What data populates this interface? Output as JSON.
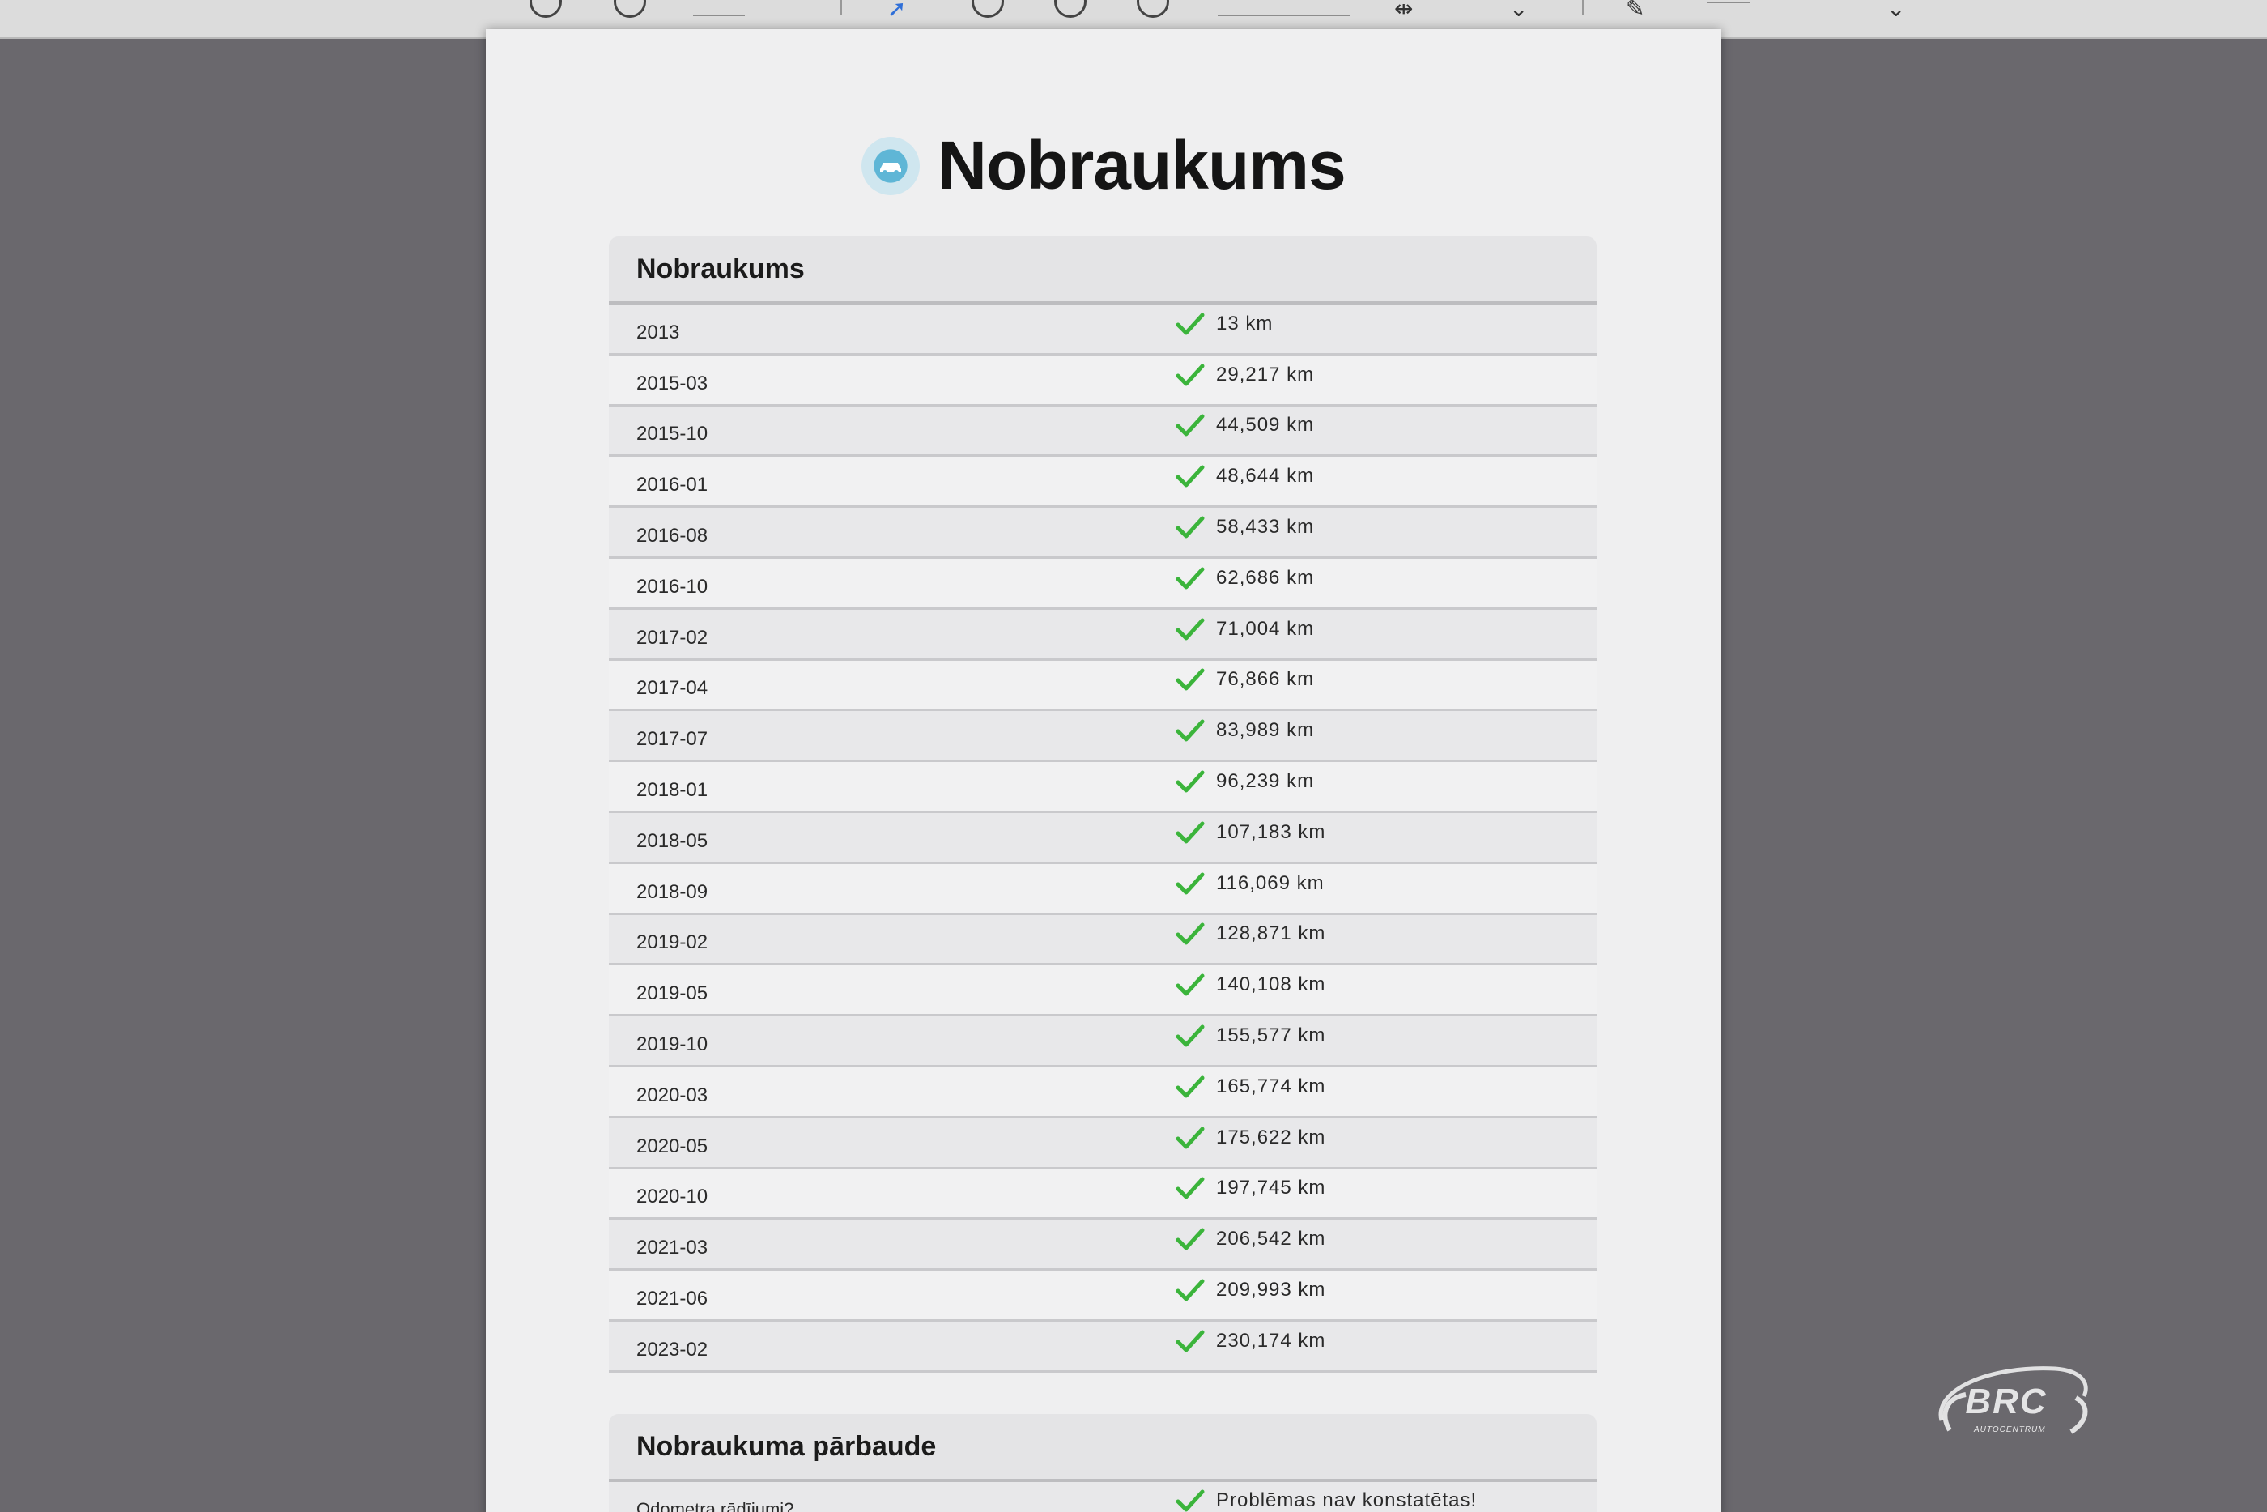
{
  "page": {
    "title": "Nobraukums"
  },
  "mileage": {
    "heading": "Nobraukums",
    "rows": [
      {
        "date": "2013",
        "value": "13 km"
      },
      {
        "date": "2015-03",
        "value": "29,217 km"
      },
      {
        "date": "2015-10",
        "value": "44,509 km"
      },
      {
        "date": "2016-01",
        "value": "48,644 km"
      },
      {
        "date": "2016-08",
        "value": "58,433 km"
      },
      {
        "date": "2016-10",
        "value": "62,686 km"
      },
      {
        "date": "2017-02",
        "value": "71,004 km"
      },
      {
        "date": "2017-04",
        "value": "76,866 km"
      },
      {
        "date": "2017-07",
        "value": "83,989 km"
      },
      {
        "date": "2018-01",
        "value": "96,239 km"
      },
      {
        "date": "2018-05",
        "value": "107,183 km"
      },
      {
        "date": "2018-09",
        "value": "116,069 km"
      },
      {
        "date": "2019-02",
        "value": "128,871 km"
      },
      {
        "date": "2019-05",
        "value": "140,108 km"
      },
      {
        "date": "2019-10",
        "value": "155,577 km"
      },
      {
        "date": "2020-03",
        "value": "165,774 km"
      },
      {
        "date": "2020-05",
        "value": "175,622 km"
      },
      {
        "date": "2020-10",
        "value": "197,745 km"
      },
      {
        "date": "2021-03",
        "value": "206,542 km"
      },
      {
        "date": "2021-06",
        "value": "209,993 km"
      },
      {
        "date": "2023-02",
        "value": "230,174 km"
      }
    ]
  },
  "check": {
    "heading": "Nobraukuma pārbaude",
    "rows": [
      {
        "label": "Odometra rādījumi?",
        "value": "Problēmas nav konstatētas!"
      }
    ]
  },
  "watermark": {
    "text": "BRC",
    "subtext": "AUTOCENTRUM"
  },
  "colors": {
    "check": "#3bb43b",
    "badge": "#5fb6d6"
  },
  "icons": {
    "badge": "car-badge-icon",
    "check": "checkmark-icon"
  }
}
